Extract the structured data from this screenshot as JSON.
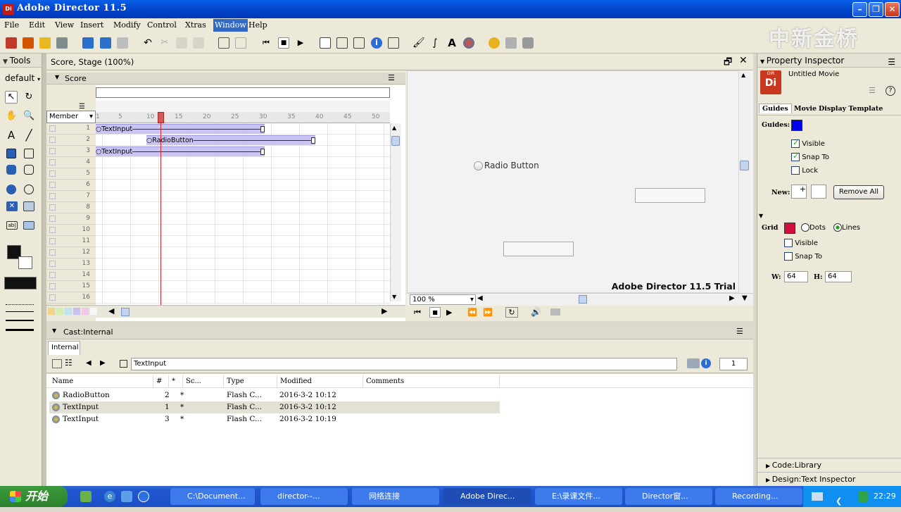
{
  "window": {
    "title": "Adobe Director 11.5",
    "app_icon": "Di"
  },
  "menu": [
    "File",
    "Edit",
    "View",
    "Insert",
    "Modify",
    "Control",
    "Xtras",
    "Window",
    "Help"
  ],
  "watermark": "中新金桥",
  "tools": {
    "title": "Tools",
    "mode": "default"
  },
  "score_window": {
    "title": "Score, Stage (100%)",
    "score_title": "Score",
    "member_select": "Member",
    "frame_ticks": [
      "1",
      "5",
      "10",
      "15",
      "20",
      "25",
      "30",
      "35",
      "40",
      "45",
      "50"
    ],
    "channels": [
      "1",
      "2",
      "3",
      "4",
      "5",
      "6",
      "7",
      "8",
      "9",
      "10",
      "11",
      "12",
      "13",
      "14",
      "15",
      "16"
    ],
    "sprites": [
      {
        "channel": 1,
        "label": "TextInput",
        "start": 1,
        "end": 30
      },
      {
        "channel": 2,
        "label": "RadioButton",
        "start": 10,
        "end": 39
      },
      {
        "channel": 3,
        "label": "TextInput",
        "start": 1,
        "end": 30
      }
    ],
    "playhead_frame": 12
  },
  "stage": {
    "radio_label": "Radio Button",
    "trial_text": "Adobe Director 11.5 Trial",
    "zoom": "100 %"
  },
  "cast": {
    "title": "Cast:Internal",
    "tab": "Internal",
    "selected_member": "TextInput",
    "member_number": "1",
    "columns": [
      "Name",
      "#",
      "*",
      "Sc...",
      "Type",
      "Modified",
      "Comments"
    ],
    "rows": [
      {
        "name": "RadioButton",
        "num": "2",
        "star": "*",
        "type": "Flash C...",
        "modified": "2016-3-2 10:12"
      },
      {
        "name": "TextInput",
        "num": "1",
        "star": "*",
        "type": "Flash C...",
        "modified": "2016-3-2 10:12"
      },
      {
        "name": "TextInput",
        "num": "3",
        "star": "*",
        "type": "Flash C...",
        "modified": "2016-3-2 10:19"
      }
    ]
  },
  "property_inspector": {
    "title": "Property Inspector",
    "movie": "Untitled Movie",
    "icon_text": "Di",
    "icon_sub": "DIR",
    "tabs": [
      "Guides",
      "Movie",
      "Display Template"
    ],
    "guides_label": "Guides:",
    "visible": "Visible",
    "snap_to": "Snap To",
    "lock": "Lock",
    "new_label": "New:",
    "remove_all": "Remove All",
    "grid_label": "Grid",
    "dots": "Dots",
    "lines": "Lines",
    "grid_visible": "Visible",
    "grid_snap": "Snap To",
    "w_label": "W:",
    "w_value": "64",
    "h_label": "H:",
    "h_value": "64",
    "footer1": "Code:Library",
    "footer2": "Design:Text Inspector"
  },
  "taskbar": {
    "start": "开始",
    "tasks": [
      "C:\\Document...",
      "director--...",
      "网络连接",
      "Adobe Direc...",
      "E:\\录课文件...",
      "Director窗...",
      "Recording..."
    ],
    "clock": "22:29"
  },
  "colors": {
    "title_blue": "#0142c9",
    "sprite_fill": "#c9c4f0",
    "playhead": "#d0222a",
    "guide_color": "#0000ee",
    "grid_color": "#d0103a"
  }
}
